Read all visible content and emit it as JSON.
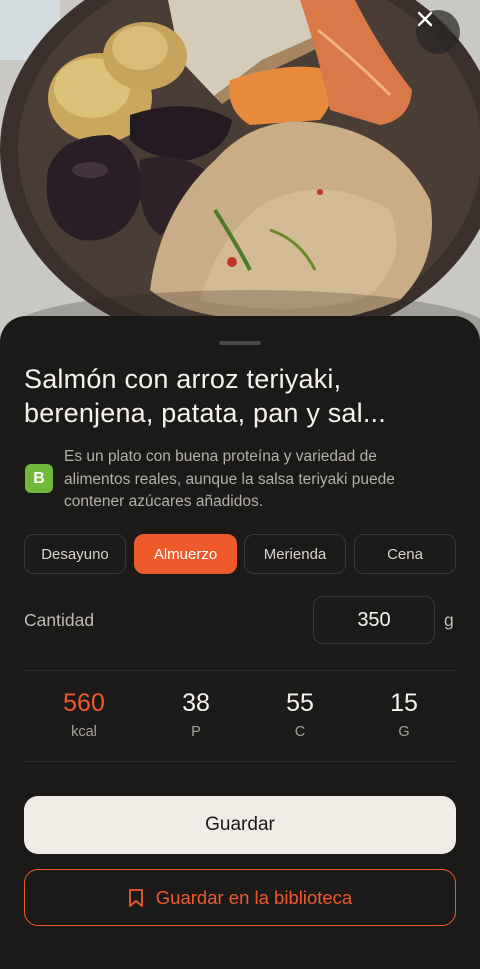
{
  "photo": {
    "alt_subject": "plate"
  },
  "close_button": {
    "icon": "close-icon"
  },
  "food": {
    "title": "Salmón con arroz teriyaki, berenjena, patata, pan y sal...",
    "grade": "B",
    "grade_color": "#72b83a",
    "description": "Es un plato con buena proteína y variedad de alimentos reales, aunque la salsa teriyaki puede contener azúcares añadidos."
  },
  "meals": {
    "options": [
      "Desayuno",
      "Almuerzo",
      "Merienda",
      "Cena"
    ],
    "selected": "Almuerzo"
  },
  "quantity": {
    "label": "Cantidad",
    "value": "350",
    "unit": "g"
  },
  "macros": {
    "kcal": {
      "value": "560",
      "label": "kcal"
    },
    "protein": {
      "value": "38",
      "label": "P"
    },
    "carbs": {
      "value": "55",
      "label": "C"
    },
    "fat": {
      "value": "15",
      "label": "G"
    }
  },
  "actions": {
    "save_label": "Guardar",
    "library_label": "Guardar en la biblioteca",
    "library_icon": "bookmark-icon"
  },
  "colors": {
    "accent": "#ef5a2c",
    "background": "#1b1a19",
    "primary_button": "#f1ede6"
  }
}
